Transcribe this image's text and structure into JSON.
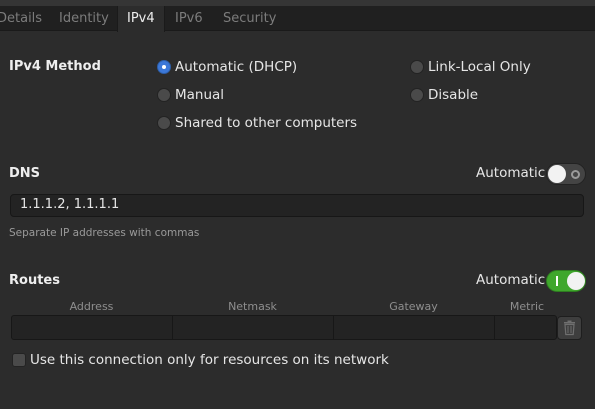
{
  "tabs": [
    {
      "label": "Details"
    },
    {
      "label": "Identity"
    },
    {
      "label": "IPv4"
    },
    {
      "label": "IPv6"
    },
    {
      "label": "Security"
    }
  ],
  "active_tab": "IPv4",
  "ipv4_method": {
    "label": "IPv4 Method",
    "options": {
      "automatic_dhcp": {
        "label": "Automatic (DHCP)",
        "selected": true
      },
      "link_local_only": {
        "label": "Link-Local Only",
        "selected": false
      },
      "manual": {
        "label": "Manual",
        "selected": false
      },
      "disable": {
        "label": "Disable",
        "selected": false
      },
      "shared": {
        "label": "Shared to other computers",
        "selected": false
      }
    }
  },
  "dns": {
    "label": "DNS",
    "automatic_label": "Automatic",
    "automatic_on": false,
    "value": "1.1.1.2, 1.1.1.1",
    "hint": "Separate IP addresses with commas"
  },
  "routes": {
    "label": "Routes",
    "automatic_label": "Automatic",
    "automatic_on": true,
    "columns": {
      "address": "Address",
      "netmask": "Netmask",
      "gateway": "Gateway",
      "metric": "Metric"
    },
    "delete_icon": "trash-icon"
  },
  "restrict_connection": {
    "label": "Use this connection only for resources on its network",
    "checked": false
  },
  "colors": {
    "accent_blue": "#3c78d8",
    "switch_on_green": "#3fa72c",
    "background": "#2c2c2c"
  }
}
